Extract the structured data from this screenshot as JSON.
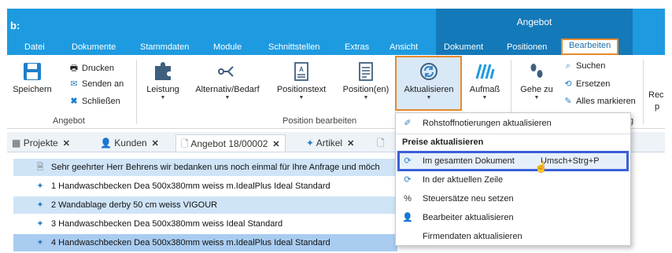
{
  "app": {
    "logo": "b:"
  },
  "context_group": {
    "title": "Angebot"
  },
  "menu": {
    "items": [
      "Datei",
      "Dokumente",
      "Stammdaten",
      "Module",
      "Schnittstellen",
      "Extras",
      "Ansicht"
    ],
    "context_items": [
      "Dokument",
      "Positionen"
    ],
    "active": "Bearbeiten"
  },
  "ribbon": {
    "save": "Speichern",
    "print": "Drucken",
    "send": "Senden an",
    "close": "Schließen",
    "group_angebot": "Angebot",
    "leistung": "Leistung",
    "alternativ": "Alternativ/Bedarf",
    "positionstext": "Positionstext",
    "positionen": "Position(en)",
    "aktualisieren": "Aktualisieren",
    "aufmass": "Aufmaß",
    "gehe_zu": "Gehe zu",
    "group_position": "Position bearbeiten",
    "suchen": "Suchen",
    "ersetzen": "Ersetzen",
    "alles_markieren": "Alles markieren",
    "group_partial": "g",
    "cut_right_top": "Rec",
    "cut_right_bottom": "p"
  },
  "tabs": [
    {
      "label": "Projekte",
      "close": "✕"
    },
    {
      "label": "Kunden",
      "close": "✕"
    },
    {
      "label": "Angebot 18/00002",
      "close": "✕"
    },
    {
      "label": "Artikel",
      "close": "✕"
    }
  ],
  "rows": [
    "Sehr geehrter Herr Behrens wir bedanken uns noch einmal für Ihre Anfrage und möch",
    "1 Handwaschbecken Dea 500x380mm weiss m.IdealPlus Ideal Standard",
    "2 Wandablage derby 50 cm weiss VIGOUR",
    "3 Handwaschbecken Dea 500x380mm weiss Ideal Standard",
    "4 Handwaschbecken Dea 500x380mm weiss m.IdealPlus Ideal Standard"
  ],
  "dropdown": {
    "rohstoff": "Rohstoffnotierungen aktualisieren",
    "header": "Preise aktualisieren",
    "gesamt": "Im gesamten Dokument",
    "gesamt_shortcut": "Umsch+Strg+P",
    "zeile": "In der aktuellen Zeile",
    "steuer": "Steuersätze neu setzen",
    "bearbeiter": "Bearbeiter aktualisieren",
    "firmendaten": "Firmendaten aktualisieren"
  },
  "colors": {
    "title_blue": "#1e9be0",
    "context_blue": "#1379b8",
    "highlight_orange": "#e58a2a",
    "highlight_blue": "#3b5fd6"
  }
}
